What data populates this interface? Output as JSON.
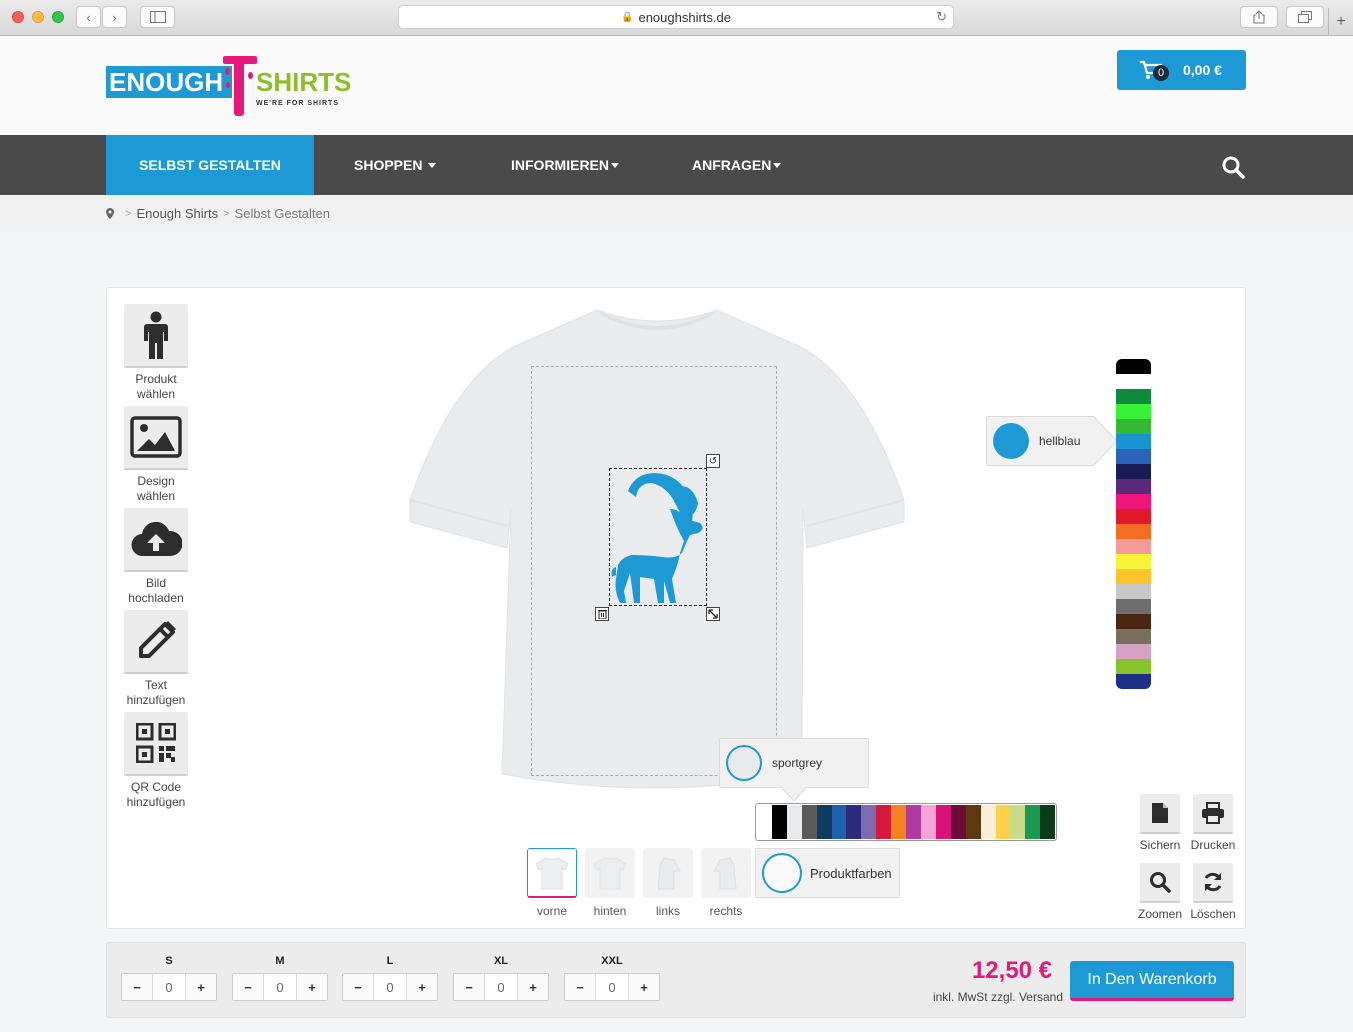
{
  "browser": {
    "url": "enoughshirts.de"
  },
  "header": {
    "logo_enough": "ENOUGH",
    "logo_shirts": "SHIRTS",
    "logo_tagline": "WE'RE FOR SHIRTS",
    "cart_count": "0",
    "cart_total": "0,00 €"
  },
  "nav": {
    "items": [
      {
        "label": "SELBST GESTALTEN"
      },
      {
        "label": "SHOPPEN"
      },
      {
        "label": "INFORMIEREN"
      },
      {
        "label": "ANFRAGEN"
      }
    ]
  },
  "breadcrumb": {
    "home": "Enough Shirts",
    "current": "Selbst Gestalten"
  },
  "tools": [
    {
      "label1": "Produkt",
      "label2": "wählen",
      "icon": "person-icon"
    },
    {
      "label1": "Design",
      "label2": "wählen",
      "icon": "image-icon"
    },
    {
      "label1": "Bild",
      "label2": "hochladen",
      "icon": "cloud-upload-icon"
    },
    {
      "label1": "Text",
      "label2": "hinzufügen",
      "icon": "pencil-icon"
    },
    {
      "label1": "QR Code",
      "label2": "hinzufügen",
      "icon": "qr-code-icon"
    }
  ],
  "design_color": {
    "name": "hellblau",
    "hex": "#1d9ad6"
  },
  "product_color": {
    "name": "sportgrey",
    "hex": "#e8eaec"
  },
  "design_palette": [
    "#000000",
    "#ffffff",
    "#0e8a3e",
    "#37f237",
    "#35b935",
    "#1a93d2",
    "#2a63b8",
    "#1a1a55",
    "#5a2a7a",
    "#f0147e",
    "#e01a2a",
    "#f46d23",
    "#f59a9a",
    "#f8f43a",
    "#fcc52c",
    "#c8c8c8",
    "#6e6e6e",
    "#4a2612",
    "#786f5e",
    "#d5a2c3",
    "#88c22d",
    "#1f2f88"
  ],
  "product_palette": [
    "#ffffff",
    "#000000",
    "#e8eaec",
    "#5a5a5a",
    "#0f3b5e",
    "#2061ae",
    "#2e2a7a",
    "#7b6bb0",
    "#d61a3c",
    "#f58220",
    "#b03aa0",
    "#f6a3d6",
    "#d9127a",
    "#6b0c35",
    "#5e3810",
    "#fceed6",
    "#fdd04a",
    "#c9dc8a",
    "#1a9a50",
    "#0a3a18"
  ],
  "views": [
    {
      "label": "vorne"
    },
    {
      "label": "hinten"
    },
    {
      "label": "links"
    },
    {
      "label": "rechts"
    }
  ],
  "product_colors_label": "Produktfarben",
  "actions": [
    {
      "label": "Sichern",
      "icon": "file-icon"
    },
    {
      "label": "Drucken",
      "icon": "print-icon"
    },
    {
      "label": "Zoomen",
      "icon": "zoom-icon"
    },
    {
      "label": "Löschen",
      "icon": "refresh-icon"
    }
  ],
  "sizes": [
    {
      "label": "S",
      "qty": "0"
    },
    {
      "label": "M",
      "qty": "0"
    },
    {
      "label": "L",
      "qty": "0"
    },
    {
      "label": "XL",
      "qty": "0"
    },
    {
      "label": "XXL",
      "qty": "0"
    }
  ],
  "price": "12,50 €",
  "price_note": "inkl. MwSt zzgl. Versand",
  "add_to_cart": "In Den Warenkorb"
}
